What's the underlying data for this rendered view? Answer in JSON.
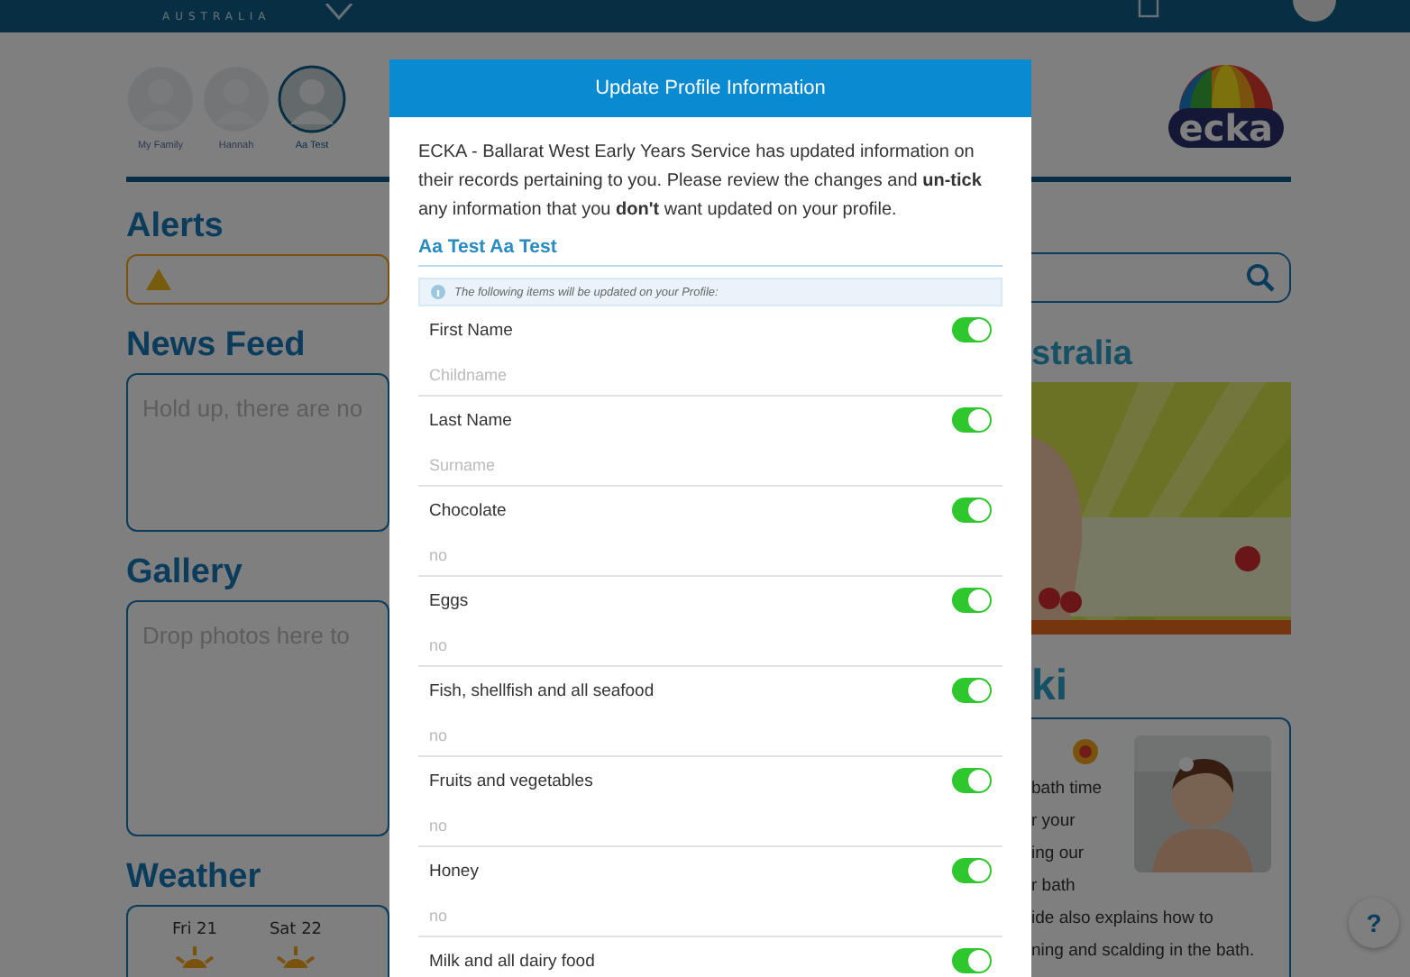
{
  "top_bar": {
    "brand_subtitle": "AUSTRALIA"
  },
  "profiles": [
    {
      "name": "My Family",
      "selected": false
    },
    {
      "name": "Hannah",
      "selected": false
    },
    {
      "name": "Aa Test",
      "selected": true
    }
  ],
  "logo": {
    "text": "ecka"
  },
  "alerts": {
    "title": "Alerts"
  },
  "news_feed": {
    "title": "News Feed",
    "placeholder": "Hold up, there are no"
  },
  "gallery": {
    "title": "Gallery",
    "placeholder": "Drop photos here to"
  },
  "weather": {
    "title": "Weather",
    "days": [
      {
        "label": "Fri 21"
      },
      {
        "label": "Sat 22"
      }
    ]
  },
  "sponsor": {
    "title": "stralia"
  },
  "article": {
    "title": "ki",
    "lines": [
      "bath time",
      "r your",
      "ing our",
      "r bath",
      "ide also explains how to",
      "ning and scalding in the bath."
    ]
  },
  "help_button": {
    "label": "?"
  },
  "modal": {
    "title": "Update Profile Information",
    "intro": "ECKA - Ballarat West Early Years Service has updated information on their records pertaining to you. Please review the changes and **un-tick** any information that you **don't** want updated on your profile.",
    "person": "Aa Test Aa Test",
    "notice": "The following items will be updated on your Profile:",
    "items": [
      {
        "label": "First Name",
        "value": "Childname",
        "on": true
      },
      {
        "label": "Last Name",
        "value": "Surname",
        "on": true
      },
      {
        "label": "Chocolate",
        "value": "no",
        "on": true
      },
      {
        "label": "Eggs",
        "value": "no",
        "on": true
      },
      {
        "label": "Fish, shellfish and all seafood",
        "value": "no",
        "on": true
      },
      {
        "label": "Fruits and vegetables",
        "value": "no",
        "on": true
      },
      {
        "label": "Honey",
        "value": "no",
        "on": true
      },
      {
        "label": "Milk and all dairy food",
        "on": true
      }
    ]
  }
}
